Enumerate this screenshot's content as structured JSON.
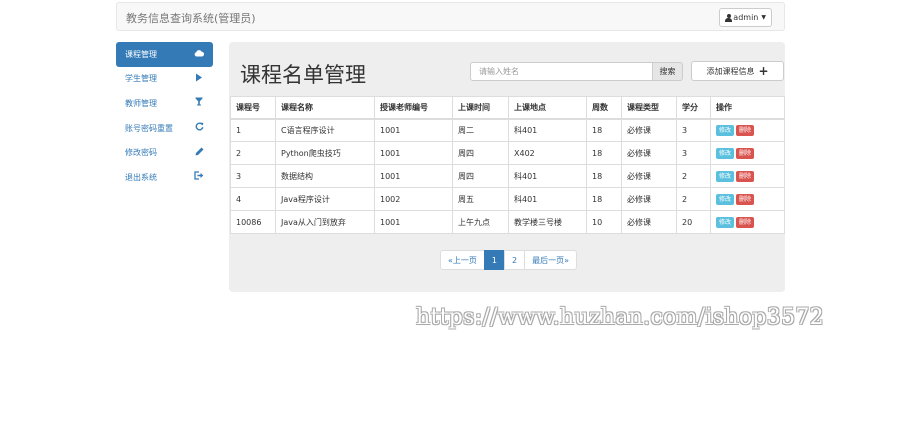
{
  "navbar": {
    "brand": "教务信息查询系统(管理员)",
    "user": "admin"
  },
  "sidebar": {
    "items": [
      {
        "label": "课程管理",
        "icon": "cloud-icon",
        "active": true
      },
      {
        "label": "学生管理",
        "icon": "play-icon"
      },
      {
        "label": "教师管理",
        "icon": "filter-icon"
      },
      {
        "label": "账号密码重置",
        "icon": "refresh-icon"
      },
      {
        "label": "修改密码",
        "icon": "pencil-icon"
      },
      {
        "label": "退出系统",
        "icon": "logout-icon"
      }
    ]
  },
  "main": {
    "title": "课程名单管理",
    "search_placeholder": "请输入姓名",
    "search_label": "搜索",
    "add_label": "添加课程信息"
  },
  "table": {
    "headers": [
      "课程号",
      "课程名称",
      "授课老师编号",
      "上课时间",
      "上课地点",
      "周数",
      "课程类型",
      "学分",
      "操作"
    ],
    "rows": [
      [
        "1",
        "C语言程序设计",
        "1001",
        "周二",
        "科401",
        "18",
        "必修课",
        "3"
      ],
      [
        "2",
        "Python爬虫技巧",
        "1001",
        "周四",
        "X402",
        "18",
        "必修课",
        "3"
      ],
      [
        "3",
        "数据结构",
        "1001",
        "周四",
        "科401",
        "18",
        "必修课",
        "2"
      ],
      [
        "4",
        "Java程序设计",
        "1002",
        "周五",
        "科401",
        "18",
        "必修课",
        "2"
      ],
      [
        "10086",
        "Java从入门到放弃",
        "1001",
        "上午九点",
        "教学楼三号楼",
        "10",
        "必修课",
        "20"
      ]
    ],
    "edit_label": "修改",
    "delete_label": "删除"
  },
  "pagination": {
    "first": "«上一页",
    "pages": [
      "1",
      "2"
    ],
    "active": "1",
    "last": "最后一页»"
  },
  "watermark": "https://www.huzhan.com/ishop3572",
  "colors": {
    "primary": "#337ab7",
    "edit": "#5bc0de",
    "delete": "#d9534f"
  }
}
